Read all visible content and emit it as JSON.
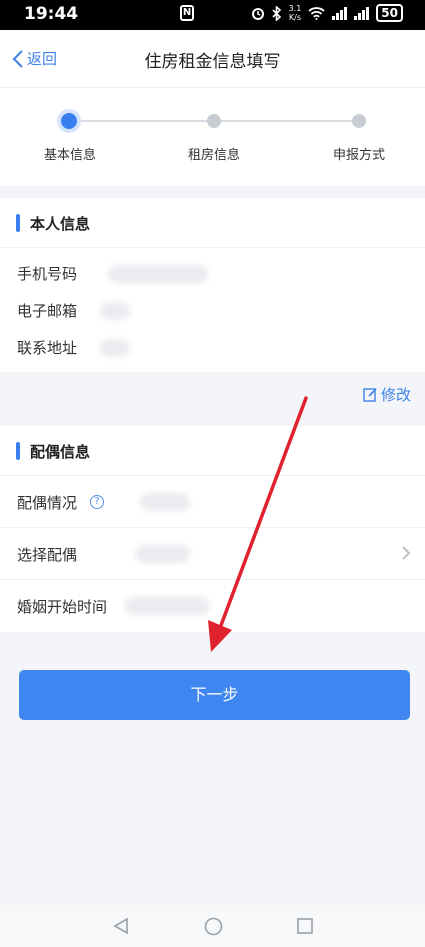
{
  "status_bar": {
    "time": "19:44",
    "net_speed_top": "3.1",
    "net_speed_bottom": "K/s",
    "battery": "50"
  },
  "nav": {
    "back_label": "返回",
    "title": "住房租金信息填写"
  },
  "steps": [
    {
      "label": "基本信息",
      "active": true
    },
    {
      "label": "租房信息",
      "active": false
    },
    {
      "label": "申报方式",
      "active": false
    }
  ],
  "personal": {
    "title": "本人信息",
    "fields": [
      {
        "label": "手机号码"
      },
      {
        "label": "电子邮箱"
      },
      {
        "label": "联系地址"
      }
    ],
    "edit_label": "修改"
  },
  "spouse": {
    "title": "配偶信息",
    "fields": [
      {
        "label": "配偶情况"
      },
      {
        "label": "选择配偶"
      },
      {
        "label": "婚姻开始时间"
      }
    ]
  },
  "next_button": "下一步",
  "colors": {
    "accent": "#3f86f0",
    "annotation_arrow": "#e0222e"
  }
}
